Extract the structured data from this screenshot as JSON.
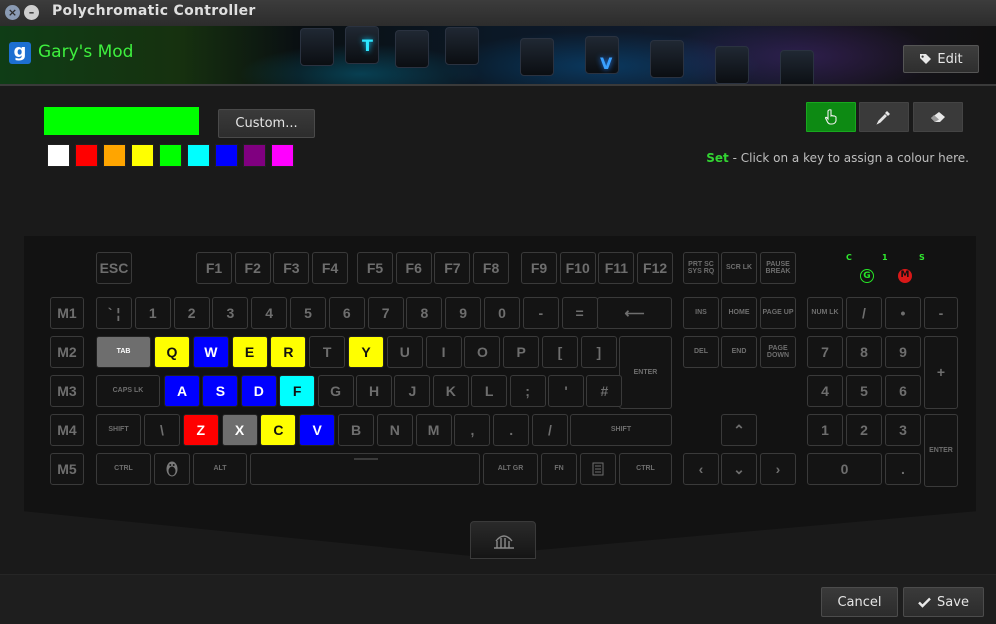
{
  "window": {
    "title": "Polychromatic Controller",
    "close": "×",
    "minimize": "–"
  },
  "header": {
    "game_name": "Gary's Mod",
    "game_icon_letter": "g",
    "edit_label": "Edit"
  },
  "banner_glyphs": [
    "T",
    "V"
  ],
  "picker": {
    "current_color": "#00ff00",
    "custom_label": "Custom...",
    "swatches": [
      "#ffffff",
      "#ff0000",
      "#ffa500",
      "#ffff00",
      "#00ff00",
      "#00ffff",
      "#0000ff",
      "#800080",
      "#ff00ff"
    ]
  },
  "tools": {
    "set": "hand-pointer-icon",
    "pick": "eyedropper-icon",
    "erase": "eraser-icon"
  },
  "hint": {
    "mode": "Set",
    "text": " - Click on a key to assign a colour here."
  },
  "leds": {
    "c": "C",
    "one": "1",
    "s": "S",
    "g": "G",
    "m": "M"
  },
  "keys": {
    "esc": "ESC",
    "f1": "F1",
    "f2": "F2",
    "f3": "F3",
    "f4": "F4",
    "f5": "F5",
    "f6": "F6",
    "f7": "F7",
    "f8": "F8",
    "f9": "F9",
    "f10": "F10",
    "f11": "F11",
    "f12": "F12",
    "prtsc": "PRT SC SYS RQ",
    "scrlk": "SCR LK",
    "pause": "PAUSE BREAK",
    "m1": "M1",
    "m2": "M2",
    "m3": "M3",
    "m4": "M4",
    "m5": "M5",
    "grave": "` ¦",
    "d1": "1",
    "d2": "2",
    "d3": "3",
    "d4": "4",
    "d5": "5",
    "d6": "6",
    "d7": "7",
    "d8": "8",
    "d9": "9",
    "d0": "0",
    "minus": "-",
    "equal": "=",
    "backspace": "⟵",
    "ins": "INS",
    "home": "HOME",
    "pgup": "PAGE UP",
    "numlk": "NUM LK",
    "nslash": "/",
    "nstar": "•",
    "nminus": "-",
    "tab": "TAB",
    "q": "Q",
    "w": "W",
    "e": "E",
    "r": "R",
    "t": "T",
    "y": "Y",
    "u": "U",
    "i": "I",
    "o": "O",
    "p": "P",
    "lbr": "[",
    "rbr": "]",
    "enter": "ENTER",
    "del": "DEL",
    "end": "END",
    "pgdn": "PAGE DOWN",
    "n7": "7",
    "n8": "8",
    "n9": "9",
    "nplus": "+",
    "caps": "CAPS LK",
    "a": "A",
    "s": "S",
    "d": "D",
    "f": "F",
    "g": "G",
    "h": "H",
    "j": "J",
    "k": "K",
    "l": "L",
    "semi": ";",
    "quote": "'",
    "hash": "#",
    "n4": "4",
    "n5": "5",
    "n6": "6",
    "lshift": "SHIFT",
    "bslash": "\\",
    "z": "Z",
    "x": "X",
    "c": "C",
    "v": "V",
    "b": "B",
    "n": "N",
    "m": "M",
    "comma": ",",
    "period": ".",
    "slash": "/",
    "rshift": "SHIFT",
    "up": "⌃",
    "n1": "1",
    "n2": "2",
    "n3": "3",
    "nenter": "ENTER",
    "lctrl": "CTRL",
    "super": "",
    "lalt": "ALT",
    "space": "",
    "altgr": "ALT GR",
    "fn": "FN",
    "menu": "",
    "rctrl": "CTRL",
    "left": "‹",
    "down": "⌄",
    "right": "›",
    "n0": "0",
    "ndot": "."
  },
  "footer": {
    "cancel": "Cancel",
    "save": "Save"
  }
}
